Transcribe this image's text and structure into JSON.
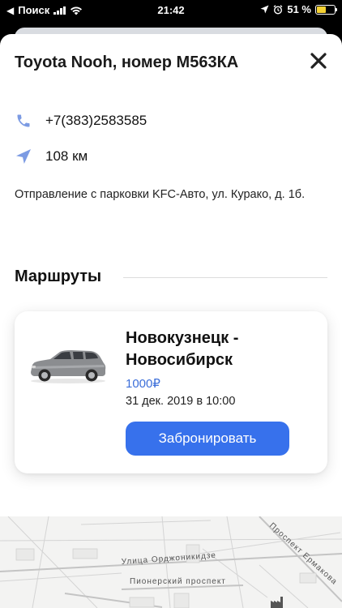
{
  "status_bar": {
    "carrier": "Поиск",
    "time": "21:42",
    "battery": "51 %",
    "battery_level": 0.51,
    "battery_color": "#f5d233"
  },
  "sheet": {
    "title": "Toyota Nooh, номер М563КА",
    "close_icon": "close-icon",
    "phone": "+7(383)2583585",
    "distance": "108 км",
    "address": "Отправление с парковки KFC-Авто, ул. Курако, д. 1б."
  },
  "routes": {
    "section_title": "Маршруты",
    "items": [
      {
        "name": "Новокузнецк - Новосибирск",
        "price": "1000₽",
        "datetime": "31 дек. 2019 в 10:00",
        "book_label": "Забронировать"
      }
    ]
  },
  "map": {
    "streets": [
      "Улица Орджоникидзе",
      "Пионерский проспект",
      "Проспект Ермакова"
    ]
  },
  "colors": {
    "accent": "#3771ec",
    "price": "#3d6fd9",
    "icon": "#7c9be3"
  }
}
